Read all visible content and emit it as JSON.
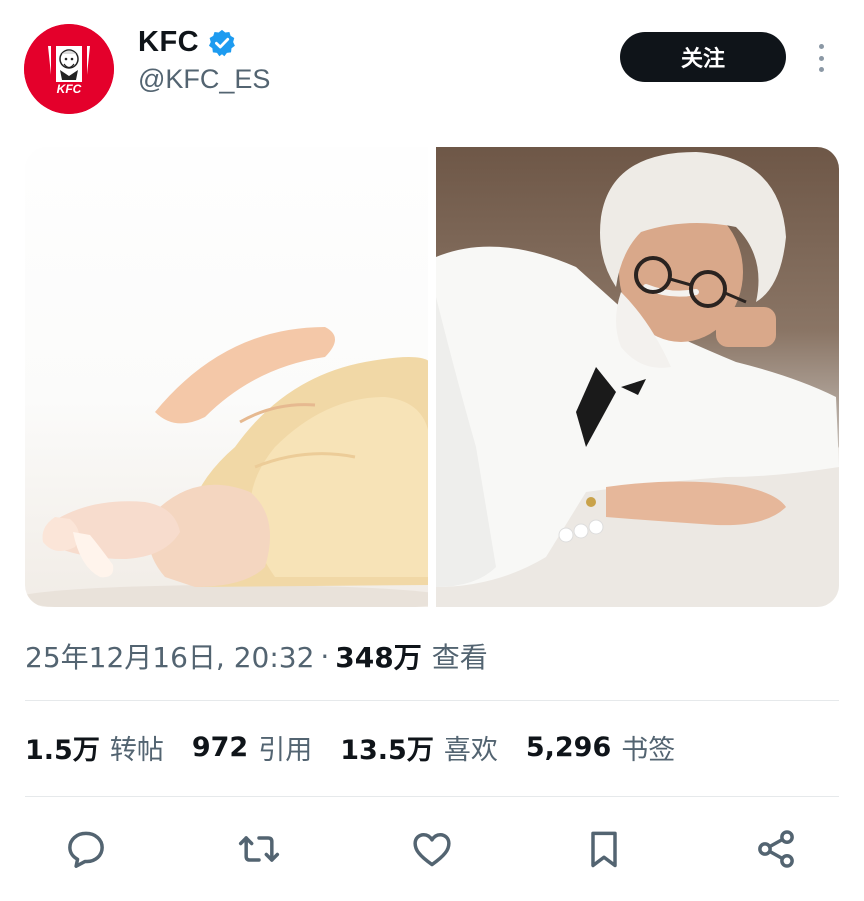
{
  "account": {
    "display_name": "KFC",
    "handle": "@KFC_ES",
    "avatar_icon": "kfc-logo",
    "logo_text": "KFC",
    "verified_icon": "verified-badge-icon",
    "verified_color": "#1d9bf0"
  },
  "header": {
    "follow_label": "关注",
    "more_icon": "more-dots-icon"
  },
  "media": {
    "images": [
      "raw-chicken-photo",
      "colonel-sanders-lying-photo"
    ]
  },
  "meta": {
    "timestamp": "25年12月16日, 20:32",
    "separator": "·",
    "views_count": "348万",
    "views_label": "查看"
  },
  "stats": [
    {
      "value": "1.5万",
      "label": "转帖"
    },
    {
      "value": "972",
      "label": "引用"
    },
    {
      "value": "13.5万",
      "label": "喜欢"
    },
    {
      "value": "5,296",
      "label": "书签"
    }
  ],
  "actions": {
    "icons": [
      "reply-icon",
      "repost-icon",
      "like-icon",
      "bookmark-icon",
      "share-icon"
    ]
  },
  "colors": {
    "text_primary": "#0f1419",
    "text_secondary": "#536471",
    "brand_red": "#e4002b",
    "follow_button": "#0f1419"
  }
}
